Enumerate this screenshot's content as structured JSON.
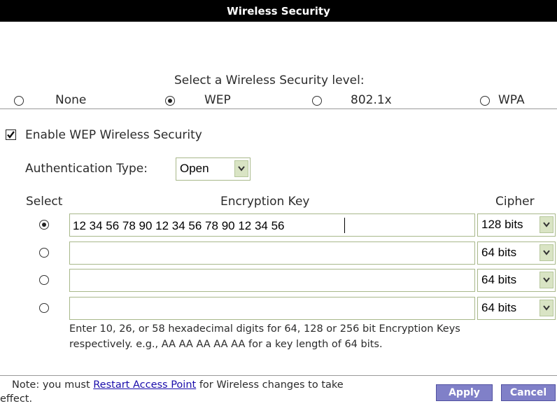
{
  "header": {
    "title": "Wireless Security"
  },
  "security_level": {
    "prompt": "Select a Wireless Security level:",
    "options": [
      {
        "label": "None",
        "selected": false
      },
      {
        "label": "WEP",
        "selected": true
      },
      {
        "label": "802.1x",
        "selected": false
      },
      {
        "label": "WPA",
        "selected": false
      }
    ]
  },
  "wep": {
    "enable_label": "Enable WEP Wireless Security",
    "enabled": true,
    "auth_label": "Authentication Type:",
    "auth_value": "Open",
    "columns": {
      "select": "Select",
      "key": "Encryption Key",
      "cipher": "Cipher"
    },
    "keys": [
      {
        "selected": true,
        "value": "12 34 56 78 90 12 34 56 78 90 12 34 56",
        "cipher": "128 bits"
      },
      {
        "selected": false,
        "value": "",
        "cipher": "64 bits"
      },
      {
        "selected": false,
        "value": "",
        "cipher": "64 bits"
      },
      {
        "selected": false,
        "value": "",
        "cipher": "64 bits"
      }
    ],
    "help_text": "Enter 10, 26, or 58 hexadecimal digits for 64, 128 or 256 bit Encryption Keys respectively. e.g., AA AA AA AA AA for a key length of 64 bits."
  },
  "footer": {
    "note_prefix": "Note: you must ",
    "note_link": "Restart Access Point",
    "note_suffix": " for Wireless changes to take",
    "note_line2": "effect.",
    "apply_label": "Apply",
    "cancel_label": "Cancel"
  },
  "colors": {
    "title_bar": "#000000",
    "button": "#8080c8",
    "select_arrow": "#d9e4c4",
    "input_border": "#a8b88a"
  }
}
